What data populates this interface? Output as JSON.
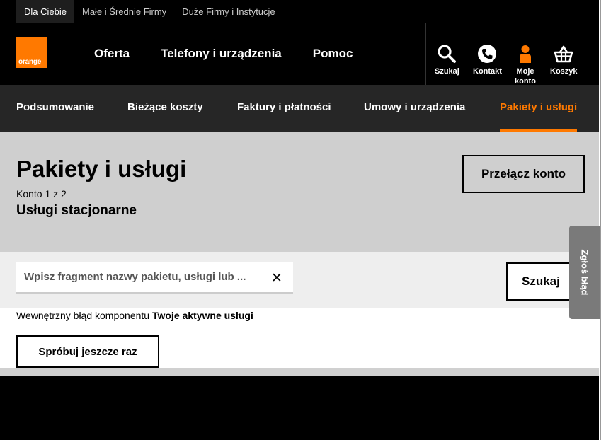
{
  "top_strip": {
    "tabs": [
      "Dla Ciebie",
      "Małe i Średnie Firmy",
      "Duże Firmy i Instytucje"
    ]
  },
  "header": {
    "logo_text": "orange",
    "nav": [
      "Oferta",
      "Telefony i urządzenia",
      "Pomoc"
    ],
    "utilities": {
      "search": "Szukaj",
      "contact": "Kontakt",
      "account_line1": "Moje",
      "account_line2": "konto",
      "cart": "Koszyk"
    }
  },
  "subnav": [
    "Podsumowanie",
    "Bieżące koszty",
    "Faktury i płatności",
    "Umowy i urządzenia",
    "Pakiety i usługi"
  ],
  "hero": {
    "title": "Pakiety i usługi",
    "account_count": "Konto 1 z 2",
    "account_name": "Usługi stacjonarne",
    "switch_label": "Przełącz konto"
  },
  "search": {
    "placeholder": "Wpisz fragment nazwy pakietu, usługi lub ...",
    "clear_symbol": "✕",
    "button_label": "Szukaj"
  },
  "content": {
    "error_prefix": "Wewnętrzny błąd komponentu",
    "error_component": "Twoje aktywne usługi",
    "retry_label": "Spróbuj jeszcze raz"
  },
  "feedback": {
    "label": "Zgłoś błąd"
  },
  "colors": {
    "brand": "#ff7900",
    "dark": "#000000",
    "subnav_bg": "#262626",
    "hero_bg": "#cfcfcf"
  }
}
